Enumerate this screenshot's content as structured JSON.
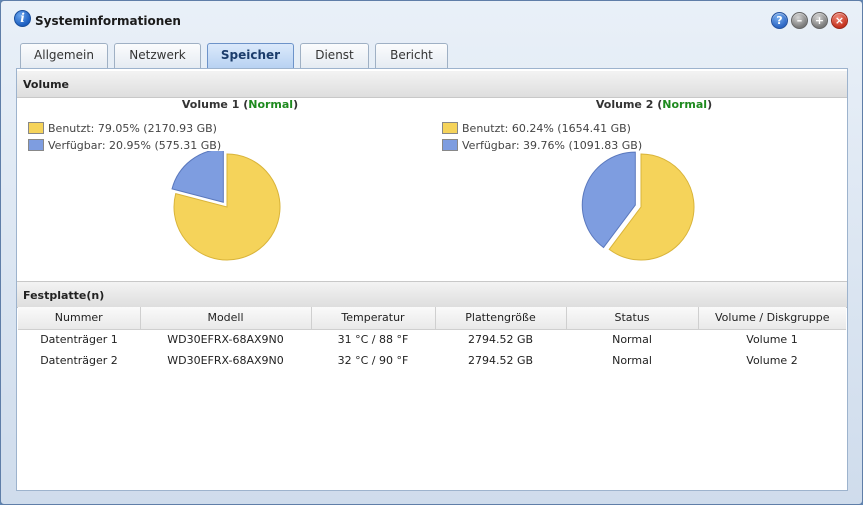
{
  "window": {
    "title": "Systeminformationen",
    "buttons": [
      "help",
      "minimize",
      "maximize",
      "close"
    ]
  },
  "tabs": [
    {
      "label": "Allgemein",
      "active": false
    },
    {
      "label": "Netzwerk",
      "active": false
    },
    {
      "label": "Speicher",
      "active": true
    },
    {
      "label": "Dienst",
      "active": false
    },
    {
      "label": "Bericht",
      "active": false
    }
  ],
  "volume_section": {
    "header": "Volume",
    "volumes": [
      {
        "name": "Volume 1",
        "status": "Normal",
        "used_label": "Benutzt: 79.05% (2170.93 GB)",
        "free_label": "Verfügbar: 20.95% (575.31 GB)",
        "used_percent": 79.05,
        "free_percent": 20.95
      },
      {
        "name": "Volume 2",
        "status": "Normal",
        "used_label": "Benutzt: 60.24% (1654.41 GB)",
        "free_label": "Verfügbar: 39.76% (1091.83 GB)",
        "used_percent": 60.24,
        "free_percent": 39.76
      }
    ]
  },
  "disk_section": {
    "header": "Festplatte(n)",
    "columns": [
      "Nummer",
      "Modell",
      "Temperatur",
      "Plattengröße",
      "Status",
      "Volume / Diskgruppe"
    ],
    "rows": [
      [
        "Datenträger 1",
        "WD30EFRX-68AX9N0",
        "31 °C / 88 °F",
        "2794.52 GB",
        "Normal",
        "Volume 1"
      ],
      [
        "Datenträger 2",
        "WD30EFRX-68AX9N0",
        "32 °C / 90 °F",
        "2794.52 GB",
        "Normal",
        "Volume 2"
      ]
    ]
  },
  "colors": {
    "used": "#f5d35a",
    "used_edge": "#d9b43a",
    "free": "#7e9de0",
    "free_edge": "#5a78bd",
    "status_normal": "#1e8a1e"
  },
  "icons": {
    "app": "info-icon",
    "help": "help-icon",
    "minimize": "minimize-icon",
    "maximize": "maximize-icon",
    "close": "close-icon"
  }
}
